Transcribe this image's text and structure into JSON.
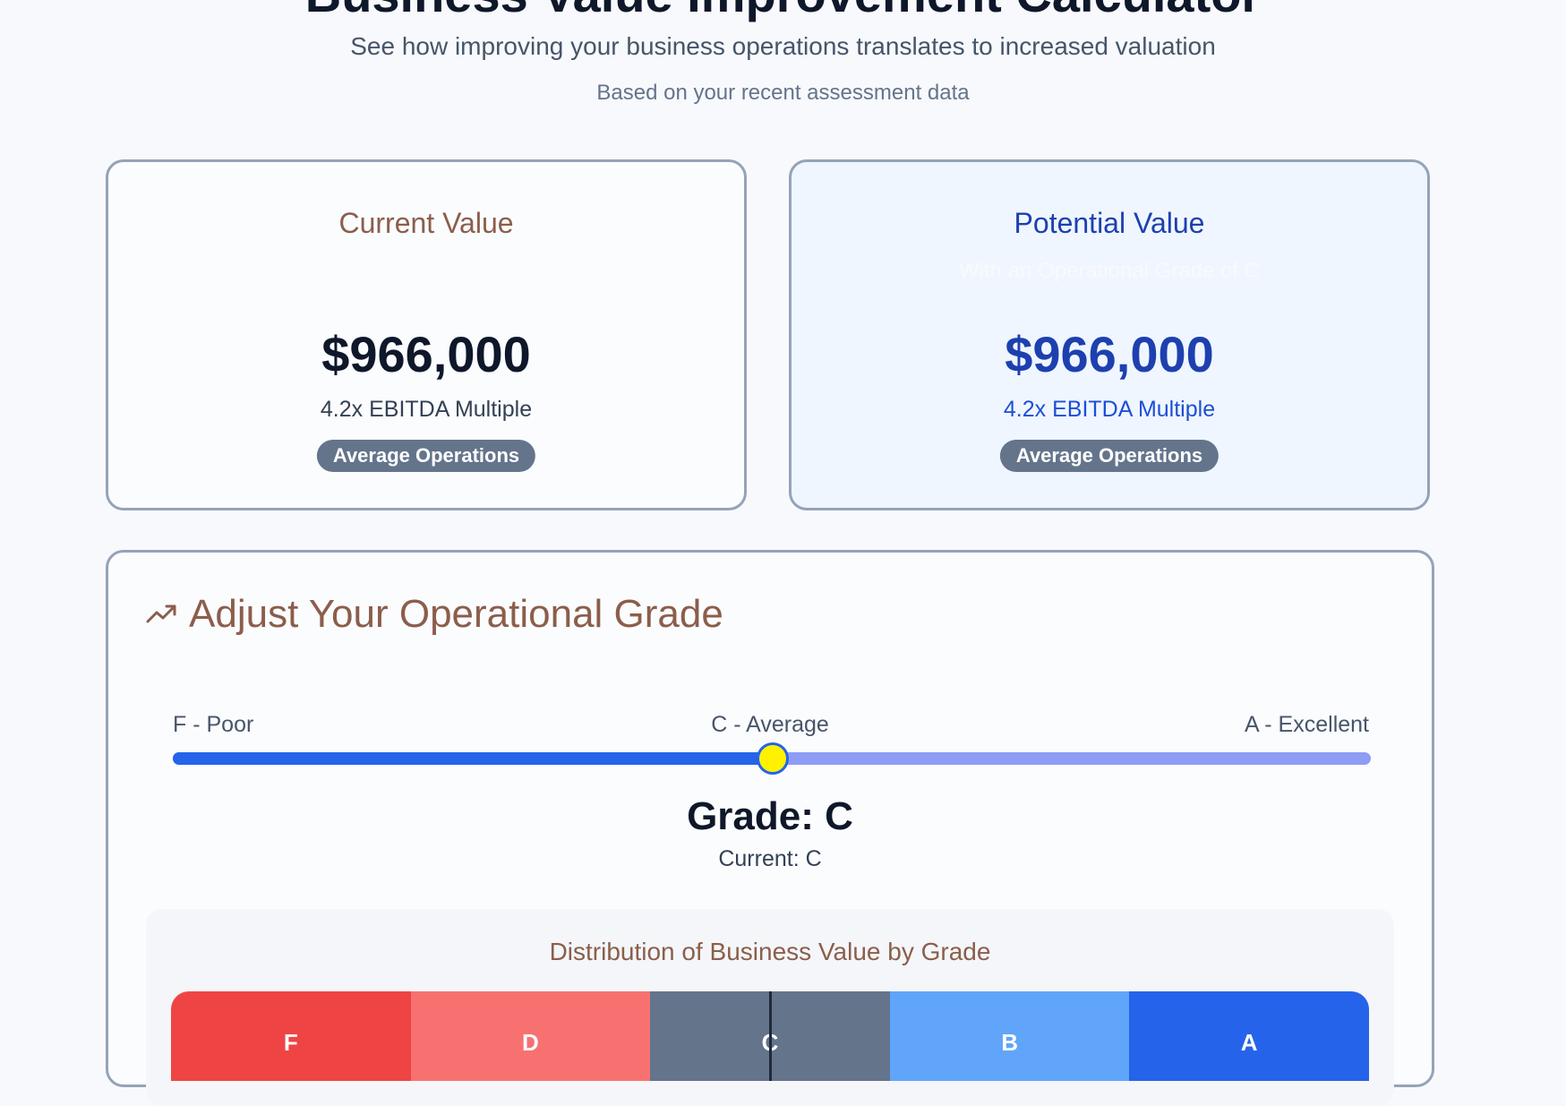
{
  "header": {
    "title": "Business Value Improvement Calculator",
    "subtitle": "See how improving your business operations translates to increased valuation",
    "note": "Based on your recent assessment data"
  },
  "current_card": {
    "title": "Current Value",
    "amount": "$966,000",
    "multiple": "4.2x EBITDA Multiple",
    "badge": "Average Operations"
  },
  "potential_card": {
    "title": "Potential Value",
    "subtitle": "With an Operational Grade of C",
    "amount": "$966,000",
    "multiple": "4.2x EBITDA Multiple",
    "badge": "Average Operations"
  },
  "grade_panel": {
    "title": "Adjust Your Operational Grade",
    "icon": "trending-up-icon",
    "scale_left": "F - Poor",
    "scale_mid": "C - Average",
    "scale_right": "A - Excellent",
    "slider_value": 0.5,
    "grade_text": "Grade: C",
    "current_text": "Current: C"
  },
  "distribution": {
    "title": "Distribution of Business Value by Grade",
    "marker_position": 0.5,
    "segments": [
      {
        "label": "F",
        "color": "#ef4444"
      },
      {
        "label": "D",
        "color": "#f87171"
      },
      {
        "label": "C",
        "color": "#64748b"
      },
      {
        "label": "B",
        "color": "#60a5fa"
      },
      {
        "label": "A",
        "color": "#2563eb"
      }
    ]
  },
  "colors": {
    "accent": "#2563eb",
    "heading_brown": "#8b5e4b",
    "potential_blue": "#1e40af",
    "badge": "#64748b",
    "slider_thumb": "#fef200",
    "slider_track": "#8e9cf5"
  }
}
